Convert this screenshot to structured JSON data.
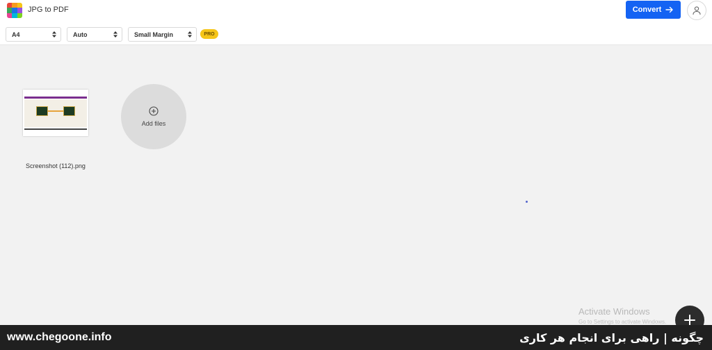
{
  "header": {
    "app_title": "JPG to PDF",
    "convert_label": "Convert",
    "logo_colors": [
      "#e8443a",
      "#f59b1f",
      "#f5c518",
      "#3aa757",
      "#1a73e8",
      "#9b51e0",
      "#e84393",
      "#00b8d9",
      "#7ed321"
    ]
  },
  "options": {
    "page_size": "A4",
    "orientation": "Auto",
    "margin": "Small Margin",
    "pro_badge": "PRO"
  },
  "files": [
    {
      "name": "Screenshot (112).png"
    }
  ],
  "add_files_label": "Add files",
  "windows_watermark": {
    "title": "Activate Windows",
    "subtitle": "Go to Settings to activate Windows."
  },
  "banner": {
    "site": "www.chegoone.info",
    "tagline": "چگونه | راهی برای انجام هر کاری"
  },
  "colors": {
    "accent": "#1463f3",
    "pro": "#f5c518"
  }
}
